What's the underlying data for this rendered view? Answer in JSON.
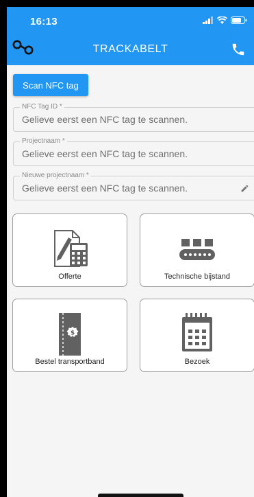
{
  "status": {
    "time": "16:13"
  },
  "header": {
    "title": "TRACKABELT"
  },
  "scan_button": {
    "label": "Scan NFC tag"
  },
  "fields": [
    {
      "label": "NFC Tag ID *",
      "value": "Gelieve eerst een NFC tag te scannen."
    },
    {
      "label": "Projectnaam *",
      "value": "Gelieve eerst een NFC tag te scannen."
    },
    {
      "label": "Nieuwe projectnaam *",
      "value": "Gelieve eerst een NFC tag te scannen."
    }
  ],
  "tiles": [
    {
      "label": "Offerte",
      "icon": "invoice-calculator-icon"
    },
    {
      "label": "Technische bijstand",
      "icon": "conveyor-belt-icon"
    },
    {
      "label": "Bestel transportband",
      "icon": "order-ticket-icon"
    },
    {
      "label": "Bezoek",
      "icon": "calendar-icon"
    }
  ],
  "colors": {
    "primary": "#2196f3",
    "background": "#f5f5f5",
    "icon": "#616161"
  }
}
